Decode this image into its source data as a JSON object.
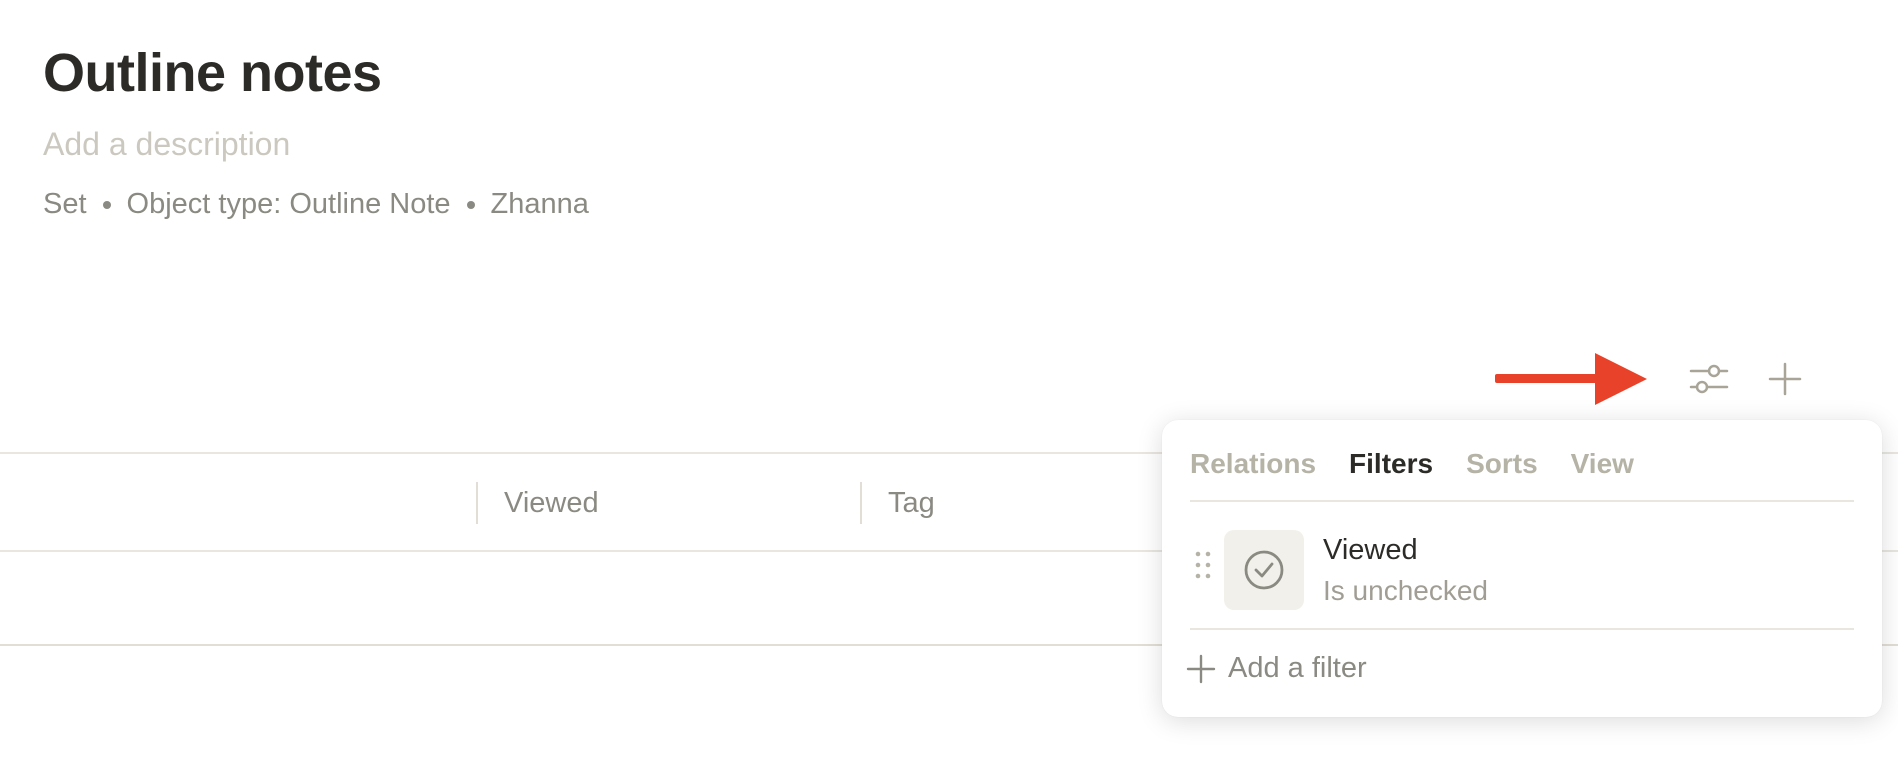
{
  "header": {
    "title": "Outline notes",
    "description_placeholder": "Add a description",
    "meta": {
      "kind": "Set",
      "object_type": "Object type: Outline Note",
      "author": "Zhanna"
    }
  },
  "toolbar": {
    "settings_icon": "sliders-icon",
    "add_icon": "plus-icon",
    "annotation_arrow_color": "#e8432a"
  },
  "table": {
    "columns": [
      "Viewed",
      "Tag"
    ]
  },
  "popup": {
    "tabs": [
      {
        "label": "Relations",
        "active": false
      },
      {
        "label": "Filters",
        "active": true
      },
      {
        "label": "Sorts",
        "active": false
      },
      {
        "label": "View",
        "active": false
      }
    ],
    "filters": [
      {
        "relation": "Viewed",
        "condition": "Is unchecked",
        "icon": "checkbox-icon"
      }
    ],
    "add_filter_label": "Add a filter"
  }
}
